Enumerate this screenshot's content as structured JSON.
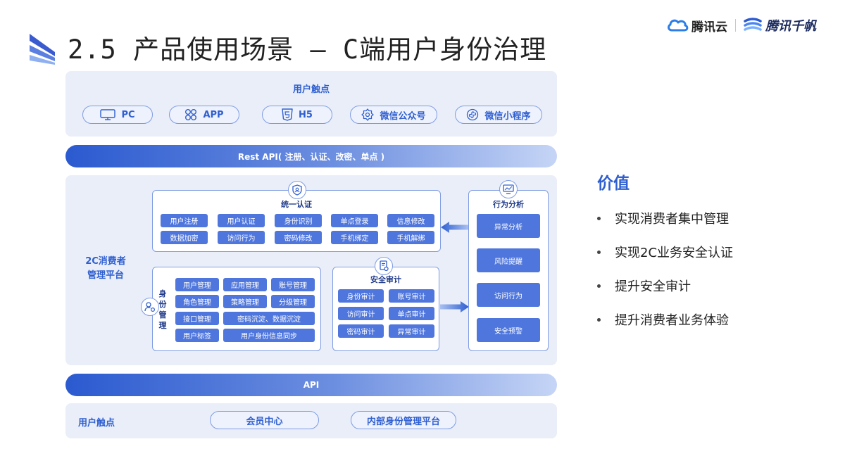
{
  "header": {
    "title": "2.5 产品使用场景 — C端用户身份治理",
    "brand_cloud": "腾讯云",
    "brand_qianfan": "腾讯千帆"
  },
  "touchpoints_top": {
    "label": "用户触点",
    "items": [
      {
        "label": "PC",
        "icon": "monitor-icon"
      },
      {
        "label": "APP",
        "icon": "app-grid-icon"
      },
      {
        "label": "H5",
        "icon": "html5-icon"
      },
      {
        "label": "微信公众号",
        "icon": "gear-badge-icon"
      },
      {
        "label": "微信小程序",
        "icon": "mini-program-icon"
      }
    ]
  },
  "rest_api": "Rest API( 注册、认证、改密、单点 )",
  "platform": {
    "label_line1": "2C消费者",
    "label_line2": "管理平台",
    "unified_auth": {
      "title": "统一认证",
      "items": [
        "用户注册",
        "用户认证",
        "身份识别",
        "单点登录",
        "信息修改",
        "数据加密",
        "访问行为",
        "密码修改",
        "手机绑定",
        "手机解绑"
      ]
    },
    "identity_mgmt": {
      "title": [
        "身",
        "份",
        "管",
        "理"
      ],
      "items": [
        "用户管理",
        "应用管理",
        "账号管理",
        "角色管理",
        "策略管理",
        "分级管理",
        "接口管理",
        "密码沉淀、数据沉淀",
        "用户标签",
        "用户身份信息同步"
      ]
    },
    "security_audit": {
      "title": "安全审计",
      "items": [
        "身份审计",
        "账号审计",
        "访问审计",
        "单点审计",
        "密码审计",
        "异常审计"
      ]
    },
    "behavior_analysis": {
      "title": "行为分析",
      "items": [
        "异常分析",
        "风险提醒",
        "访问行为",
        "安全预警"
      ]
    }
  },
  "api_bar": "API",
  "touchpoints_bottom": {
    "label": "用户触点",
    "items": [
      "会员中心",
      "内部身份管理平台"
    ]
  },
  "value": {
    "title": "价值",
    "items": [
      "实现消费者集中管理",
      "实现2C业务安全认证",
      "提升安全审计",
      "提升消费者业务体验"
    ]
  },
  "colors": {
    "accent": "#2f5fd0",
    "chip": "#4f76dc",
    "panel": "#e9eef9",
    "border": "#7f9ce3"
  }
}
